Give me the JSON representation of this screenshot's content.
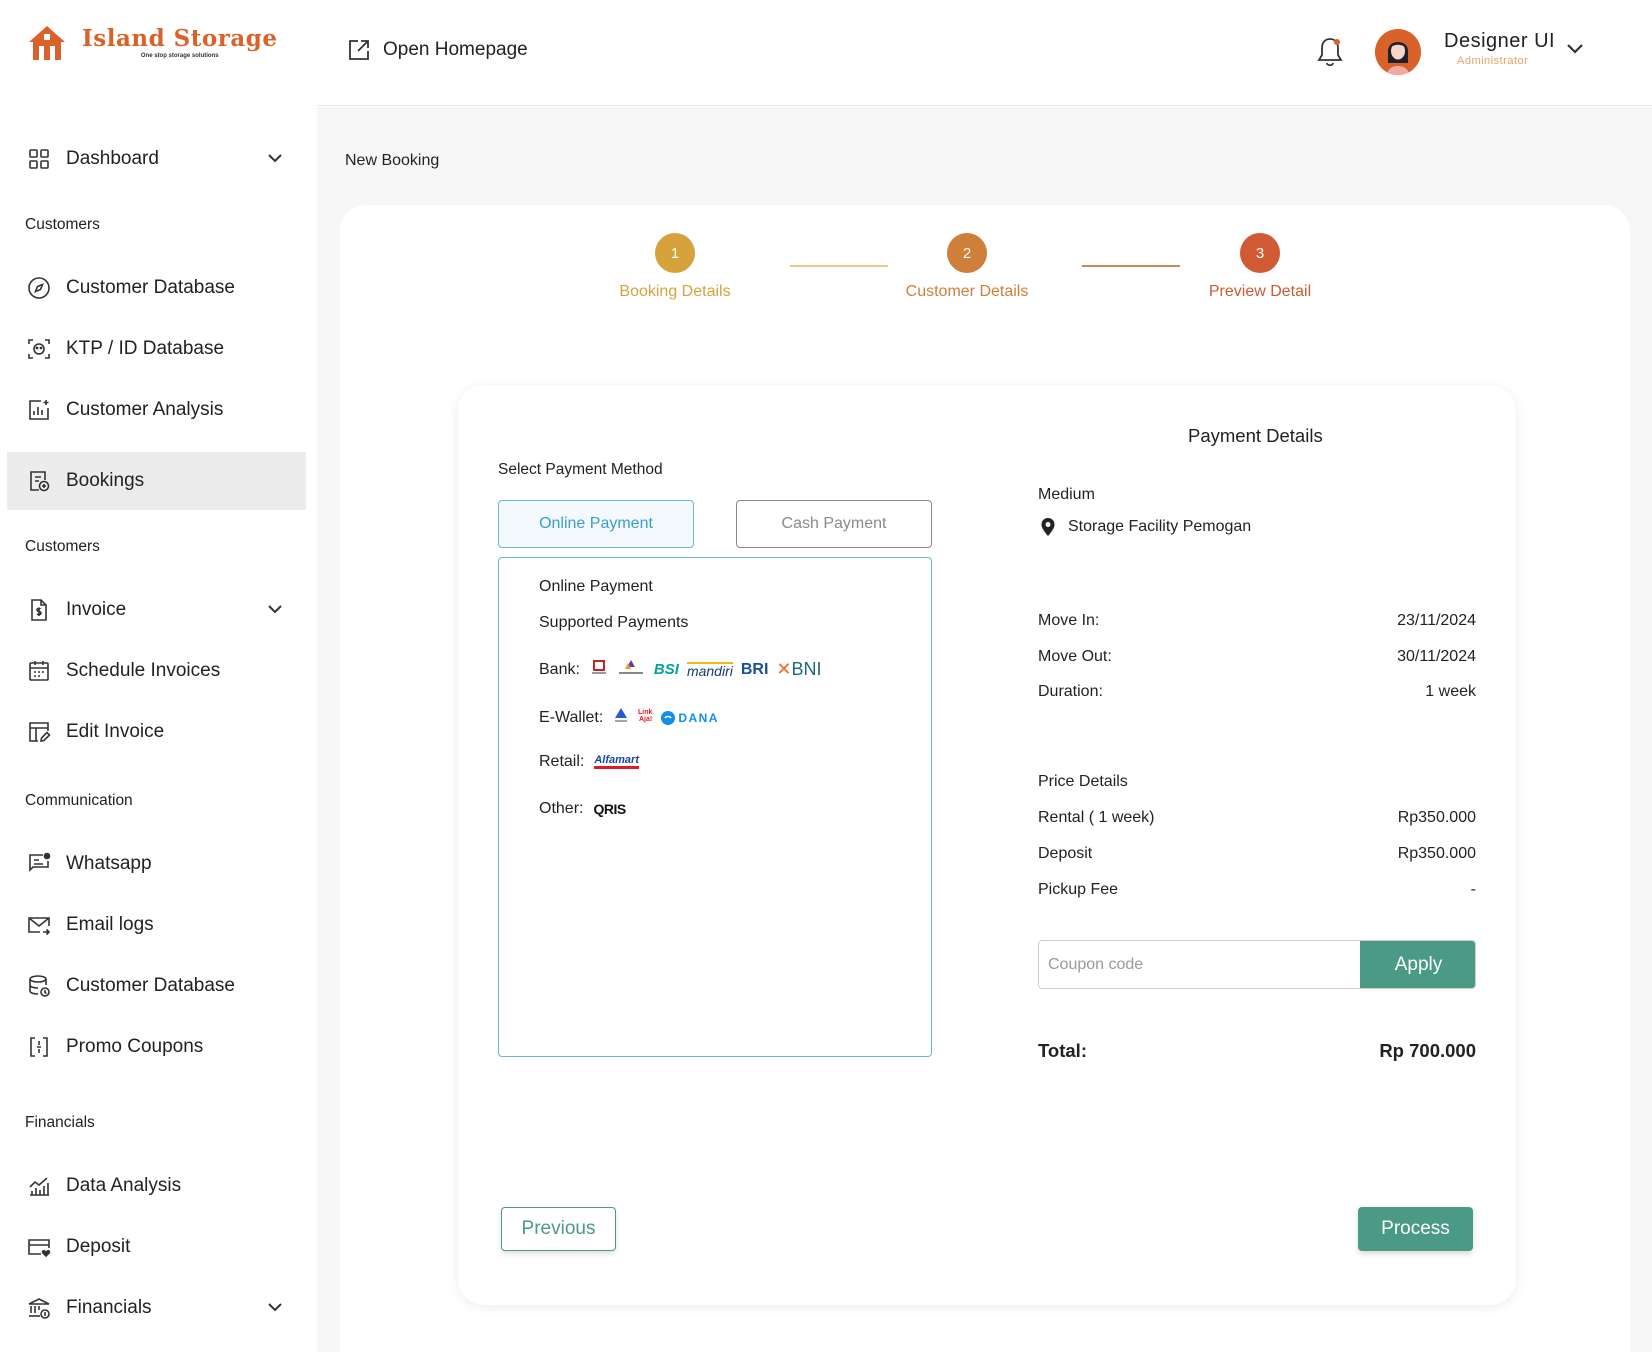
{
  "brand": {
    "name": "Island Storage",
    "tagline": "One stop storage solutions",
    "color": "#d9622b"
  },
  "header": {
    "open_homepage": "Open Homepage",
    "user_name": "Designer UI",
    "user_role": "Administrator"
  },
  "sidebar": {
    "dashboard": "Dashboard",
    "section_customers_1": "Customers",
    "customer_database": "Customer Database",
    "ktp_database": "KTP / ID Database",
    "customer_analysis": "Customer Analysis",
    "bookings": "Bookings",
    "section_customers_2": "Customers",
    "invoice": "Invoice",
    "schedule_invoices": "Schedule Invoices",
    "edit_invoice": "Edit Invoice",
    "section_communication": "Communication",
    "whatsapp": "Whatsapp",
    "email_logs": "Email logs",
    "customer_database_2": "Customer Database",
    "promo_coupons": "Promo Coupons",
    "section_financials": "Financials",
    "data_analysis": "Data Analysis",
    "deposit": "Deposit",
    "financials": "Financials"
  },
  "breadcrumb": "New Booking",
  "stepper": [
    {
      "number": "1",
      "label": "Booking Details",
      "color": "#d6a23c"
    },
    {
      "number": "2",
      "label": "Customer Details",
      "color": "#cf7f3a"
    },
    {
      "number": "3",
      "label": "Preview Detail",
      "color": "#cf5a33"
    }
  ],
  "payment_method": {
    "label": "Select Payment Method",
    "online_label": "Online Payment",
    "cash_label": "Cash Payment",
    "box_title": "Online Payment",
    "supported_title": "Supported Payments",
    "bank_label": "Bank:",
    "ewallet_label": "E-Wallet:",
    "retail_label": "Retail:",
    "other_label": "Other:",
    "bank_logos": {
      "bsi": "BSI",
      "mandiri": "mandiri",
      "bri": "BRI",
      "bni": "BNI"
    },
    "ewallet_logos": {
      "dana": "DANA"
    },
    "retail_logos": {
      "alfamart": "Alfamart"
    },
    "other_logos": {
      "qris": "QRIS"
    }
  },
  "payment_details": {
    "title": "Payment Details",
    "size_label": "Medium",
    "location": "Storage Facility Pemogan",
    "move_in_label": "Move In:",
    "move_in_value": "23/11/2024",
    "move_out_label": "Move Out:",
    "move_out_value": "30/11/2024",
    "duration_label": "Duration:",
    "duration_value": "1 week",
    "price_details_label": "Price Details",
    "rental_label": "Rental ( 1 week)",
    "rental_value": "Rp350.000",
    "deposit_label": "Deposit",
    "deposit_value": "Rp350.000",
    "pickup_label": "Pickup Fee",
    "pickup_value": "-",
    "coupon_placeholder": "Coupon code",
    "apply_label": "Apply",
    "total_label": "Total:",
    "total_value": "Rp 700.000"
  },
  "actions": {
    "previous": "Previous",
    "process": "Process",
    "accent": "#4a9a85"
  }
}
